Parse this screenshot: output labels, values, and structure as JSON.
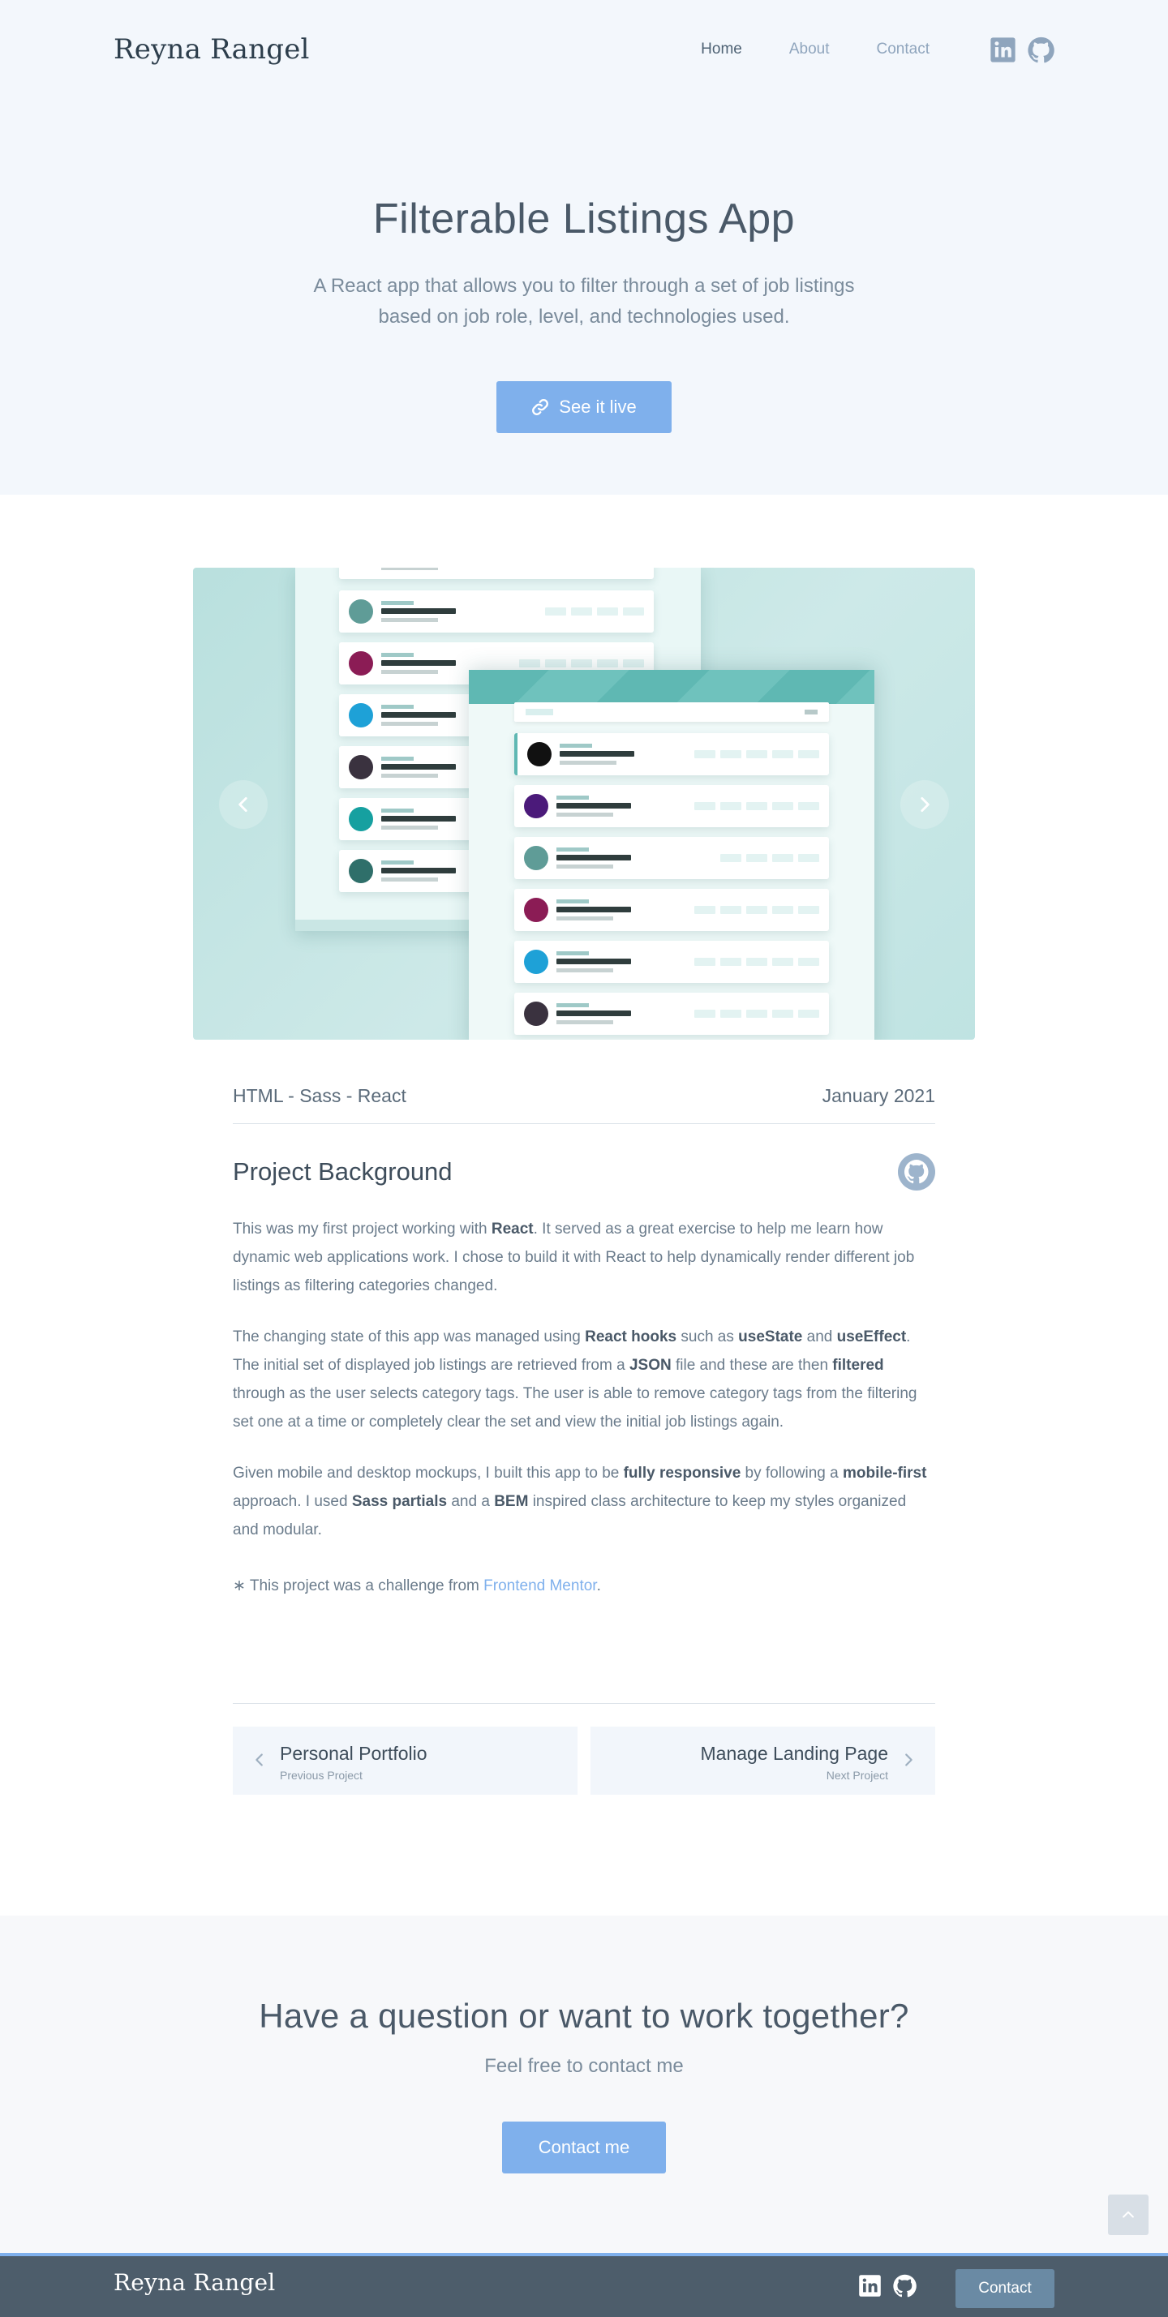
{
  "header": {
    "brand": "Reyna Rangel",
    "nav": [
      {
        "label": "Home"
      },
      {
        "label": "About"
      },
      {
        "label": "Contact"
      }
    ],
    "icons": [
      "linkedin-icon",
      "github-icon"
    ]
  },
  "hero": {
    "title": "Filterable Listings App",
    "description": "A React app that allows you to filter through a set of job listings based on job role, level, and technologies used.",
    "button_label": "See it live",
    "button_icon": "link-icon"
  },
  "carousel": {
    "prev_icon": "chevron-left-icon",
    "next_icon": "chevron-right-icon"
  },
  "project": {
    "tech": "HTML - Sass - React",
    "date": "January 2021",
    "section_title": "Project Background",
    "section_icon": "github-icon",
    "p1": {
      "a": "This was my first project working with ",
      "b": "React",
      "c": ". It served as a great exercise to help me learn how dynamic web applications work. I chose to build it with React to help dynamically render different job listings as filtering categories changed."
    },
    "p2": {
      "a": "The changing state of this app was managed using ",
      "b": "React hooks",
      "c": " such as ",
      "d": "useState",
      "e": " and ",
      "f": "useEffect",
      "g": ". The initial set of displayed job listings are retrieved from a ",
      "h": "JSON",
      "i": " file and these are then ",
      "j": "filtered",
      "k": " through as the user selects category tags. The user is able to remove category tags from the filtering set one at a time or completely clear the set and view the initial job listings again."
    },
    "p3": {
      "a": "Given mobile and desktop mockups, I built this app to be ",
      "b": "fully responsive",
      "c": " by following a ",
      "d": "mobile-first",
      "e": " approach. I used ",
      "f": "Sass partials",
      "g": " and a ",
      "h": "BEM",
      "i": " inspired class architecture to keep my styles organized and modular."
    },
    "note_prefix": "∗ This project was a challenge from ",
    "note_link": "Frontend Mentor",
    "note_suffix": "."
  },
  "pager": {
    "prev_title": "Personal Portfolio",
    "prev_sub": "Previous Project",
    "next_title": "Manage Landing Page",
    "next_sub": "Next Project"
  },
  "contact": {
    "title": "Have a question or want to work together?",
    "subtitle": "Feel free to contact me",
    "button_label": "Contact me"
  },
  "footer": {
    "brand": "Reyna Rangel",
    "button_label": "Contact"
  },
  "colors": {
    "accent": "#7fb0ec",
    "footer_bg": "#4d5d6b",
    "hero_bg": "#f3f7fc",
    "carousel_bg": "#b9e0de"
  }
}
